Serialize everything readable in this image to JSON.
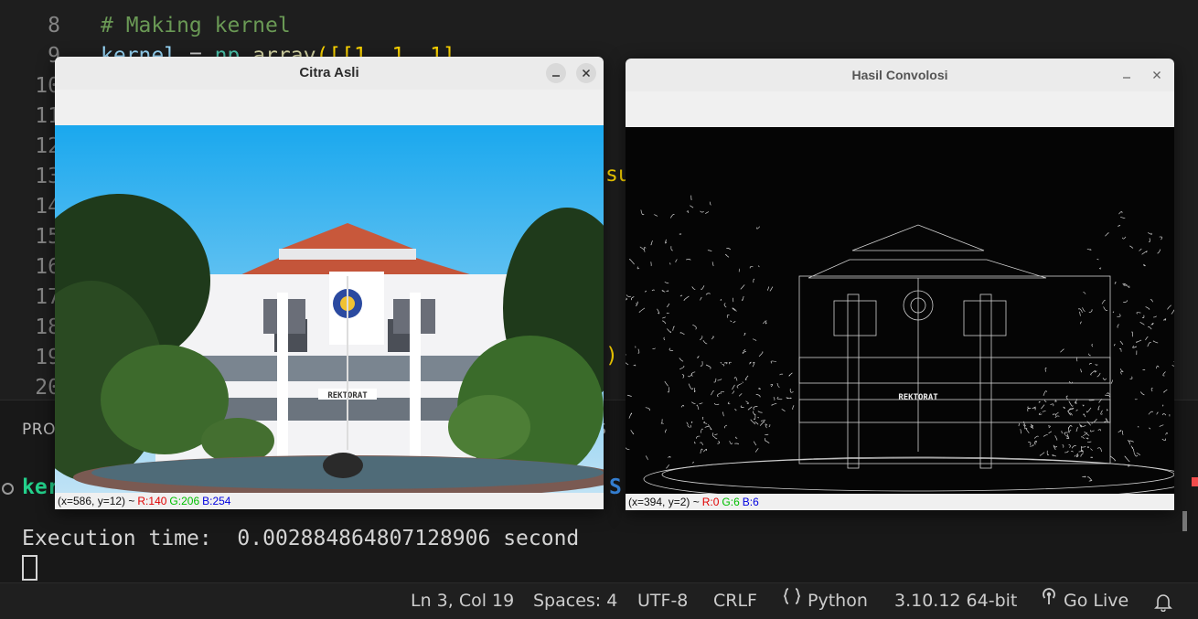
{
  "editor": {
    "lines": [
      {
        "num": "8",
        "segments": [
          {
            "cls": "c-comment",
            "text": "# Making kernel"
          }
        ]
      },
      {
        "num": "9",
        "segments": [
          {
            "cls": "c-var",
            "text": "kernel"
          },
          {
            "cls": "c-plain",
            "text": " = "
          },
          {
            "cls": "c-cyan",
            "text": "np"
          },
          {
            "cls": "c-plain",
            "text": "."
          },
          {
            "cls": "c-fn",
            "text": "array"
          },
          {
            "cls": "c-yellow",
            "text": "([[1, 1, 1]"
          }
        ]
      },
      {
        "num": "10",
        "segments": []
      },
      {
        "num": "11",
        "segments": []
      },
      {
        "num": "12",
        "segments": []
      },
      {
        "num": "13",
        "segments": []
      },
      {
        "num": "14",
        "segments": []
      },
      {
        "num": "15",
        "segments": []
      },
      {
        "num": "16",
        "segments": []
      },
      {
        "num": "17",
        "segments": []
      },
      {
        "num": "18",
        "segments": []
      },
      {
        "num": "19",
        "segments": []
      },
      {
        "num": "20",
        "segments": []
      }
    ],
    "peek_su": "su",
    "peek_paren": ")"
  },
  "panel": {
    "tab_problems": "PRO",
    "tab_right": "S",
    "prompt_fragment": "ker",
    "prompt_s": "S",
    "output": "Execution time:  0.002884864807128906 second"
  },
  "statusbar": {
    "position": "Ln 3, Col 19",
    "spaces": "Spaces: 4",
    "encoding": "UTF-8",
    "eol": "CRLF",
    "language": "Python",
    "interpreter": "3.10.12 64-bit",
    "golive": "Go Live"
  },
  "window_original": {
    "title": "Citra Asli",
    "status_coords": "(x=586, y=12) ~",
    "r": "R:140",
    "g": "G:206",
    "b": "B:254",
    "sign": "REKTORAT"
  },
  "window_result": {
    "title": "Hasil Convolosi",
    "status_coords": "(x=394, y=2) ~",
    "r": "R:0",
    "g": "G:6",
    "b": "B:6",
    "sign": "REKTORAT"
  },
  "icons": [
    "minimize-icon",
    "close-icon",
    "braces-icon",
    "broadcast-icon",
    "bell-icon"
  ]
}
